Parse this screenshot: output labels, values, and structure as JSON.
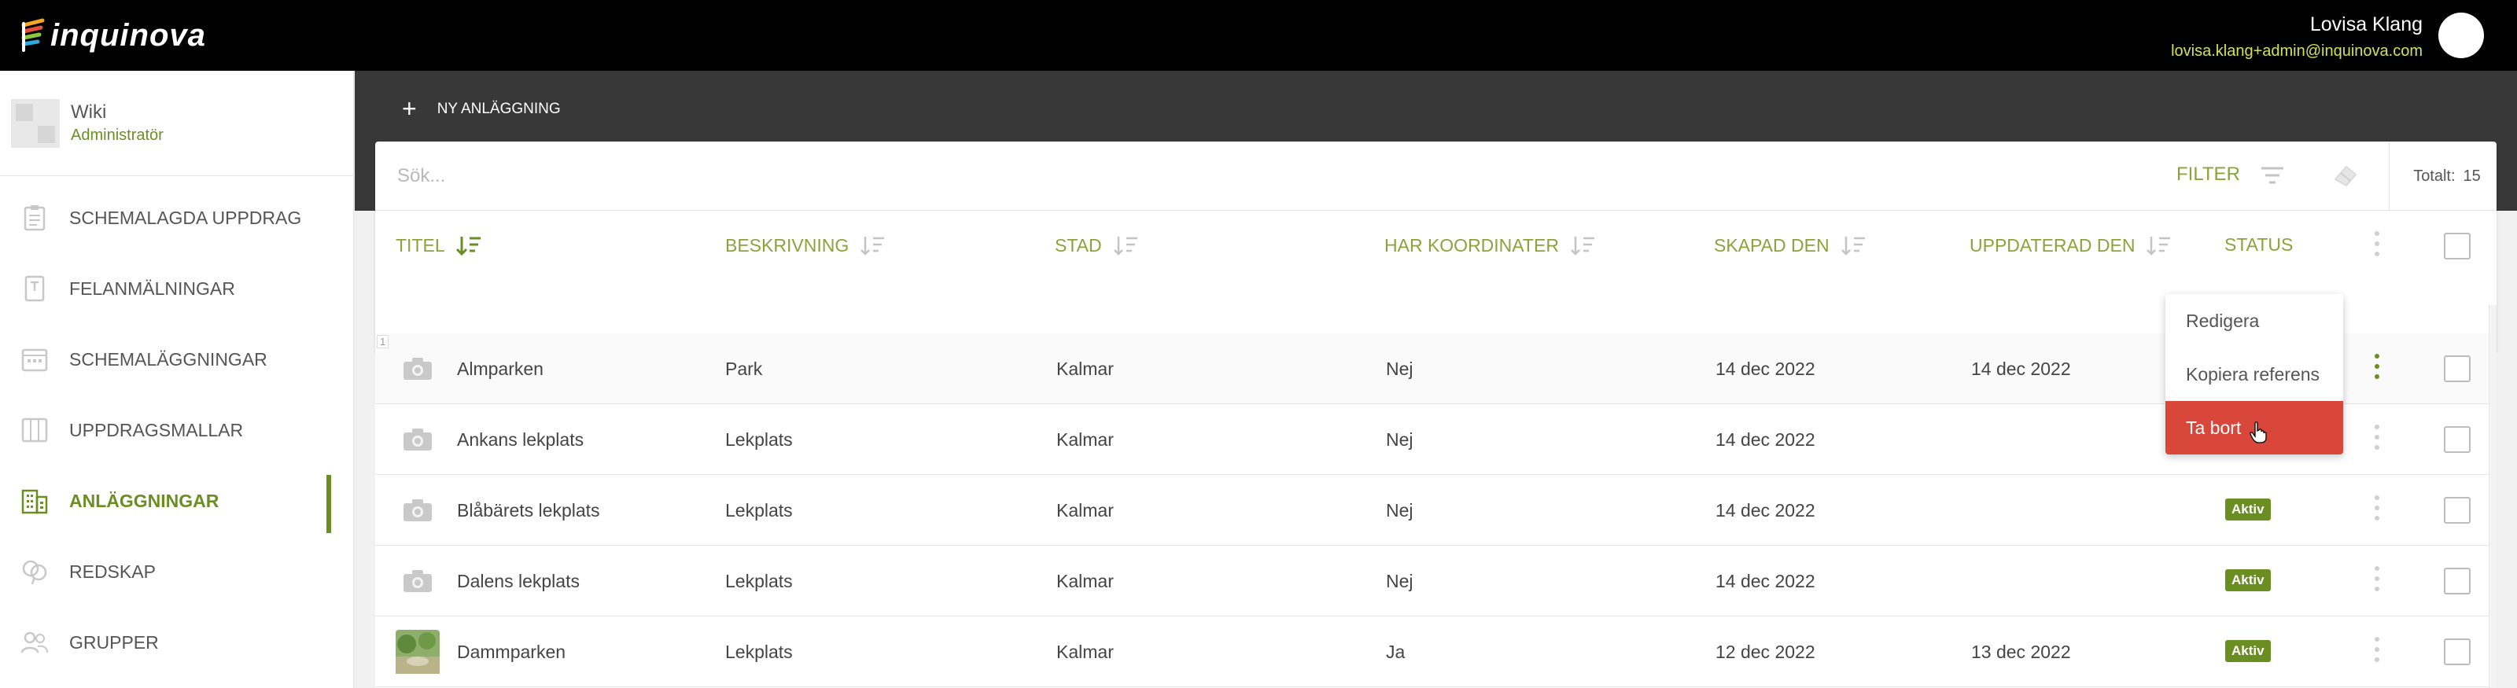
{
  "app": {
    "logo_text": "inquinova",
    "user_name": "Lovisa Klang",
    "user_email": "lovisa.klang+admin@inquinova.com"
  },
  "sidebar": {
    "org_name": "Wiki",
    "org_role": "Administratör",
    "items": [
      {
        "label": "SCHEMALAGDA UPPDRAG",
        "icon": "clipboard-icon"
      },
      {
        "label": "FELANMÄLNINGAR",
        "icon": "report-icon"
      },
      {
        "label": "SCHEMALÄGGNINGAR",
        "icon": "calendar-icon"
      },
      {
        "label": "UPPDRAGSMALLAR",
        "icon": "templates-icon"
      },
      {
        "label": "ANLÄGGNINGAR",
        "icon": "building-icon",
        "active": true
      },
      {
        "label": "REDSKAP",
        "icon": "tools-icon"
      },
      {
        "label": "GRUPPER",
        "icon": "group-icon"
      }
    ]
  },
  "toolbar": {
    "new_label": "NY ANLÄGGNING",
    "search_placeholder": "Sök...",
    "filter_label": "FILTER",
    "total_label": "Totalt:",
    "total_value": "15"
  },
  "table": {
    "columns": [
      "TITEL",
      "BESKRIVNING",
      "STAD",
      "HAR KOORDINATER",
      "SKAPAD DEN",
      "UPPDATERAD DEN",
      "STATUS"
    ],
    "row_index_label": "1",
    "rows": [
      {
        "title": "Almparken",
        "description": "Park",
        "city": "Kalmar",
        "coordinates": "Nej",
        "created": "14 dec 2022",
        "updated": "14 dec 2022",
        "status": ""
      },
      {
        "title": "Ankans lekplats",
        "description": "Lekplats",
        "city": "Kalmar",
        "coordinates": "Nej",
        "created": "14 dec 2022",
        "updated": "",
        "status": ""
      },
      {
        "title": "Blåbärets lekplats",
        "description": "Lekplats",
        "city": "Kalmar",
        "coordinates": "Nej",
        "created": "14 dec 2022",
        "updated": "",
        "status": "Aktiv"
      },
      {
        "title": "Dalens lekplats",
        "description": "Lekplats",
        "city": "Kalmar",
        "coordinates": "Nej",
        "created": "14 dec 2022",
        "updated": "",
        "status": "Aktiv"
      },
      {
        "title": "Dammparken",
        "description": "Lekplats",
        "city": "Kalmar",
        "coordinates": "Ja",
        "created": "12 dec 2022",
        "updated": "13 dec 2022",
        "status": "Aktiv"
      }
    ]
  },
  "context_menu": {
    "items": [
      "Redigera",
      "Kopiera referens",
      "Ta bort"
    ]
  },
  "colors": {
    "accent": "#6b8e23",
    "header_text": "#8aa33b",
    "danger": "#d9463a",
    "topbar": "#000000",
    "band": "#383838"
  }
}
